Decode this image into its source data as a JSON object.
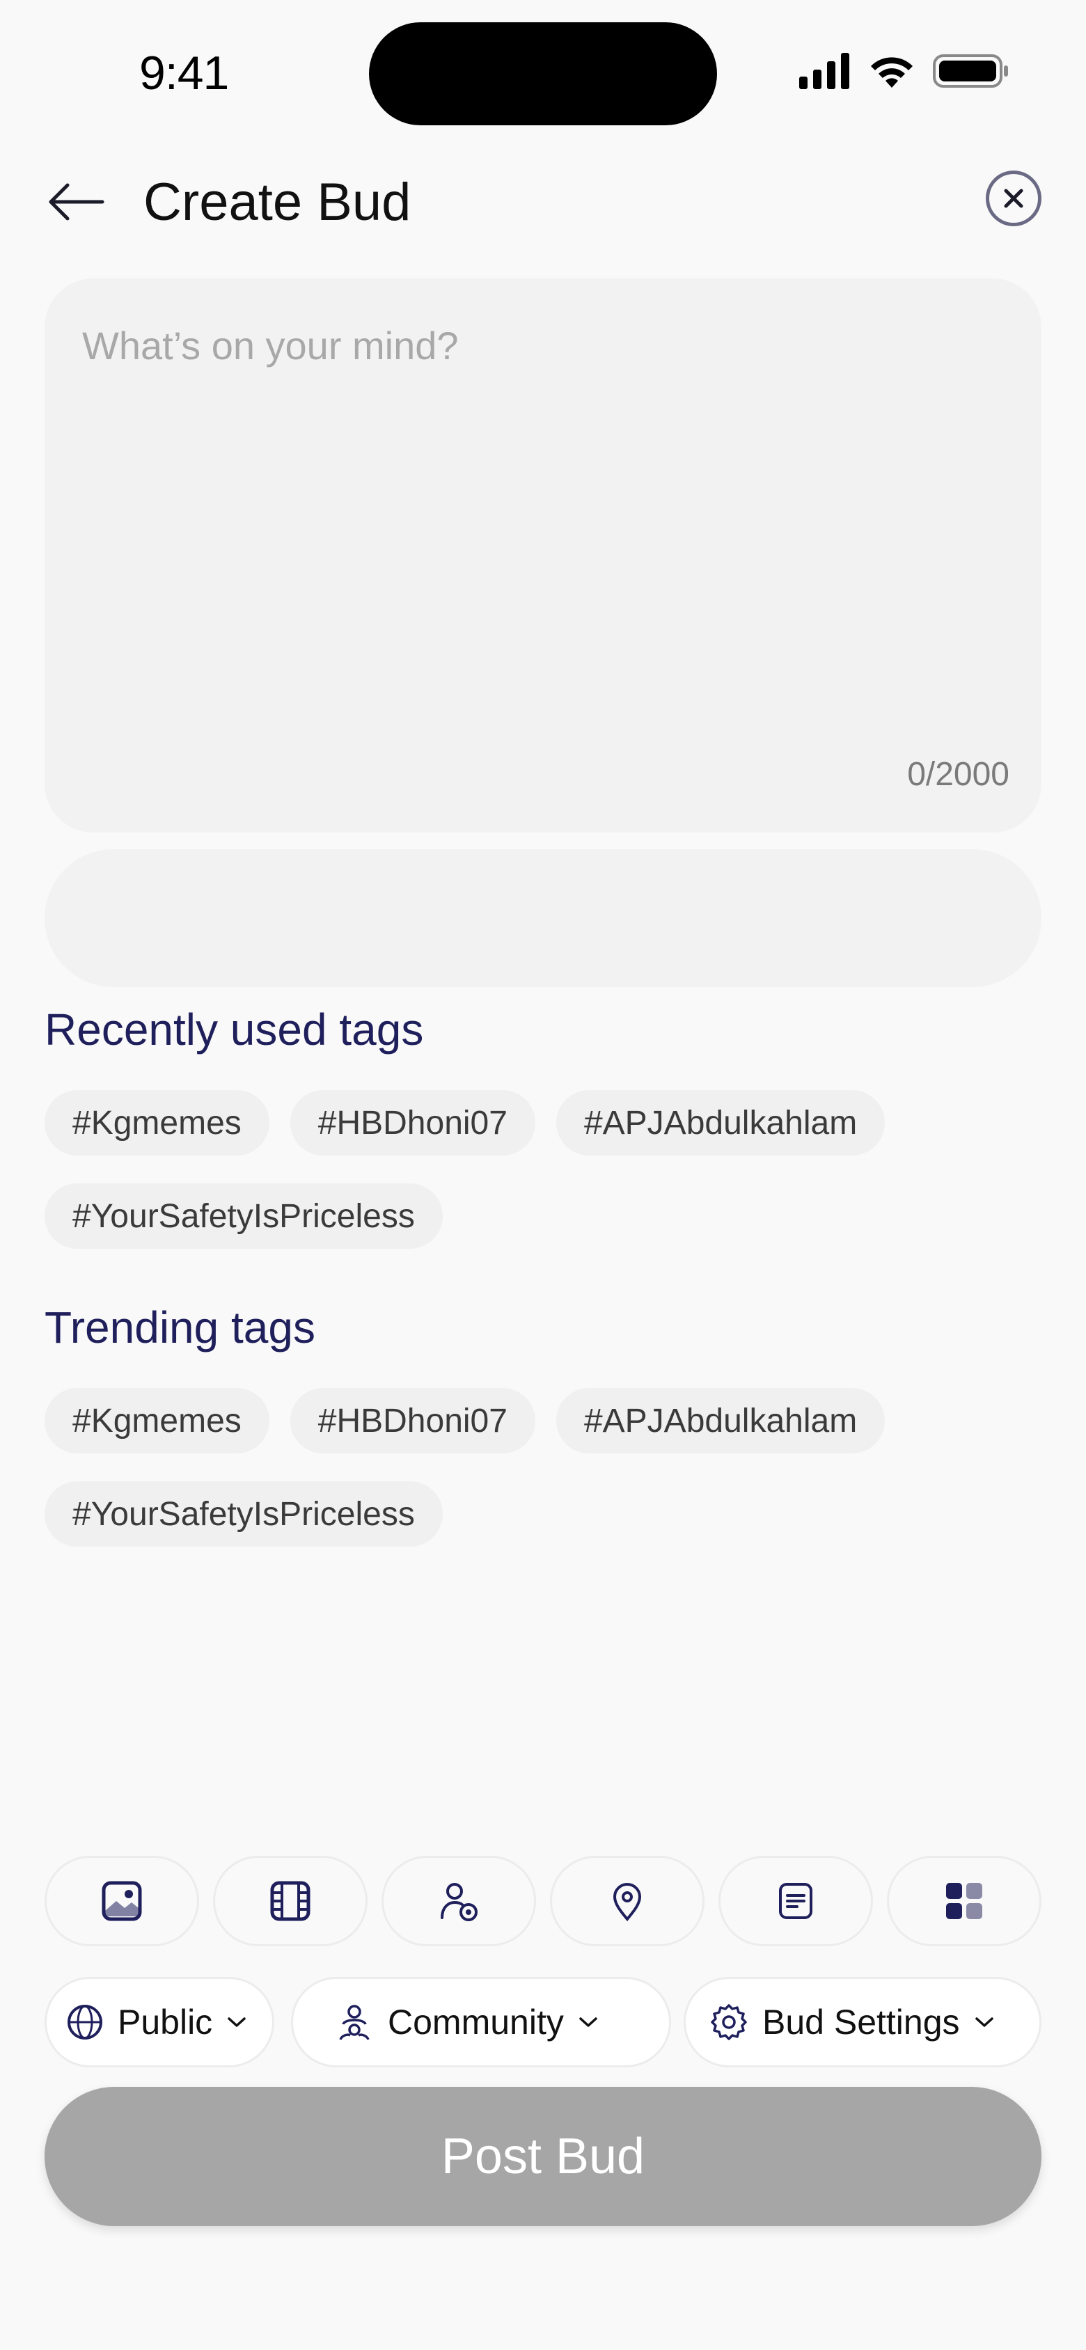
{
  "status_bar": {
    "time": "9:41"
  },
  "header": {
    "title": "Create Bud"
  },
  "composer": {
    "placeholder": "What’s on your mind?",
    "counter": "0/2000"
  },
  "recent_tags": {
    "title": "Recently used tags",
    "items": [
      "#Kgmemes",
      "#HBDhoni07",
      "#APJAbdulkahlam",
      "#YourSafetyIsPriceless"
    ]
  },
  "trending_tags": {
    "title": "Trending tags",
    "items": [
      "#Kgmemes",
      "#HBDhoni07",
      "#APJAbdulkahlam",
      "#YourSafetyIsPriceless"
    ]
  },
  "toolbar": {
    "tools": [
      "image-icon",
      "video-icon",
      "tag-people-icon",
      "location-icon",
      "document-icon",
      "more-apps-icon"
    ]
  },
  "options": {
    "visibility": "Public",
    "audience": "Community",
    "settings": "Bud Settings"
  },
  "post_button": {
    "label": "Post Bud"
  },
  "colors": {
    "accent": "#1f1f5c",
    "post_disabled": "#a6a6a6",
    "surface": "#f2f2f2",
    "background": "#f9f9f9"
  }
}
